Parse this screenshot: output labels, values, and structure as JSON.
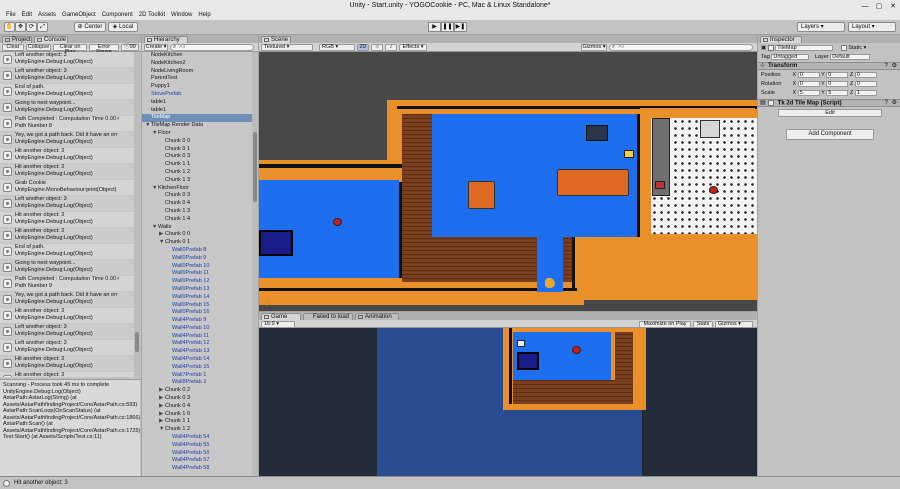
{
  "window": {
    "title": "Unity - Start.unity - YOGOCookie - PC, Mac & Linux Standalone*",
    "minimize": "—",
    "maximize": "▢",
    "close": "✕"
  },
  "menu": [
    "File",
    "Edit",
    "Assets",
    "GameObject",
    "Component",
    "2D Toolkit",
    "Window",
    "Help"
  ],
  "toolbar": {
    "pivot": "Center",
    "space": "Local",
    "play": "▶",
    "pause": "❚❚",
    "step": "▶❚",
    "layers": "Layers",
    "layout": "Layout"
  },
  "project_panel": {
    "tab_project": "Project",
    "tab_console": "Console",
    "clear": "Clear",
    "collapse": "Collapse",
    "clear_on_play": "Clear on Play",
    "error_pause": "Error Pause",
    "count": "99"
  },
  "console_logs": [
    [
      "Left another object: 3",
      "UnityEngine.Debug:Log(Object)"
    ],
    [
      "Left another object: 3",
      "UnityEngine.Debug:Log(Object)"
    ],
    [
      "End of path.",
      "UnityEngine.Debug:Log(Object)"
    ],
    [
      "Going to next waypoint...",
      "UnityEngine.Debug:Log(Object)"
    ],
    [
      "Path Completed : Computation Time 0.00 r",
      "Path Number 8"
    ],
    [
      "Yey, we got a path back. Did it have an err",
      "UnityEngine.Debug:Log(Object)"
    ],
    [
      "Hit another object: 3",
      "UnityEngine.Debug:Log(Object)"
    ],
    [
      "Hit another object: 3",
      "UnityEngine.Debug:Log(Object)"
    ],
    [
      "Grab Cookie",
      "UnityEngine.MonoBehaviour:print(Object)"
    ],
    [
      "Left another object: 3",
      "UnityEngine.Debug:Log(Object)"
    ],
    [
      "Hit another object: 3",
      "UnityEngine.Debug:Log(Object)"
    ],
    [
      "Hit another object: 3",
      "UnityEngine.Debug:Log(Object)"
    ],
    [
      "End of path.",
      "UnityEngine.Debug:Log(Object)"
    ],
    [
      "Going to next waypoint...",
      "UnityEngine.Debug:Log(Object)"
    ],
    [
      "Path Completed : Computation Time 0.00 r",
      "Path Number 9"
    ],
    [
      "Yey, we got a path back. Did it have an err",
      "UnityEngine.Debug:Log(Object)"
    ],
    [
      "Hit another object: 3",
      "UnityEngine.Debug:Log(Object)"
    ],
    [
      "Left another object: 3",
      "UnityEngine.Debug:Log(Object)"
    ],
    [
      "Left another object: 3",
      "UnityEngine.Debug:Log(Object)"
    ],
    [
      "Hit another object: 3",
      "UnityEngine.Debug:Log(Object)"
    ],
    [
      "Hit another object: 3",
      "UnityEngine.Debug:Log(Object)"
    ]
  ],
  "console_detail": "Scanning - Process took 45 ms to complete\nUnityEngine.Debug:Log(Object)\nAstarPath:AstarLog(String) (at Assets/AstarPathfindingProject/Core/AstarPath.cs:593)\nAstarPath:ScanLoop(OnScanStatus) (at Assets/AstarPathfindingProject/Core/AstarPath.cs:1866)\nAstarPath:Scan() (at Assets/AstarPathfindingProject/Core/AstarPath.cs:1725)\nTest:Start() (at Assets/Scripts/Test.cs:11)",
  "hierarchy": {
    "tab": "Hierarchy",
    "create": "Create ▾",
    "search_placeholder": "All",
    "rows": [
      {
        "label": "NodeKitchen",
        "indent": 0
      },
      {
        "label": "NodeKitchen2",
        "indent": 0
      },
      {
        "label": "NodeLivingRoom",
        "indent": 0
      },
      {
        "label": "ParentTest",
        "indent": 0
      },
      {
        "label": "Puppy1",
        "indent": 0
      },
      {
        "label": "StovePrefab",
        "indent": 0,
        "prefab": true
      },
      {
        "label": "table1",
        "indent": 0
      },
      {
        "label": "table1",
        "indent": 0
      },
      {
        "label": "TileMap",
        "indent": 0,
        "selected": true
      },
      {
        "label": "TileMap Render Data",
        "indent": 0,
        "arrow": "▼"
      },
      {
        "label": "Floor",
        "indent": 1,
        "arrow": "▼"
      },
      {
        "label": "Chunk 0 0",
        "indent": 2
      },
      {
        "label": "Chunk 0 1",
        "indent": 2
      },
      {
        "label": "Chunk 0 3",
        "indent": 2
      },
      {
        "label": "Chunk 1 1",
        "indent": 2
      },
      {
        "label": "Chunk 1 2",
        "indent": 2
      },
      {
        "label": "Chunk 1 3",
        "indent": 2
      },
      {
        "label": "KitchenFloor",
        "indent": 1,
        "arrow": "▼"
      },
      {
        "label": "Chunk 0 3",
        "indent": 2
      },
      {
        "label": "Chunk 0 4",
        "indent": 2
      },
      {
        "label": "Chunk 1 3",
        "indent": 2
      },
      {
        "label": "Chunk 1 4",
        "indent": 2
      },
      {
        "label": "Walls",
        "indent": 1,
        "arrow": "▼"
      },
      {
        "label": "Chunk 0 0",
        "indent": 2,
        "arrow": "▶"
      },
      {
        "label": "Chunk 0 1",
        "indent": 2,
        "arrow": "▼"
      },
      {
        "label": "Wall0Prefab 8",
        "indent": 3,
        "prefab": true
      },
      {
        "label": "Wall0Prefab 9",
        "indent": 3,
        "prefab": true
      },
      {
        "label": "Wall0Prefab 10",
        "indent": 3,
        "prefab": true
      },
      {
        "label": "Wall0Prefab 11",
        "indent": 3,
        "prefab": true
      },
      {
        "label": "Wall0Prefab 12",
        "indent": 3,
        "prefab": true
      },
      {
        "label": "Wall0Prefab 13",
        "indent": 3,
        "prefab": true
      },
      {
        "label": "Wall0Prefab 14",
        "indent": 3,
        "prefab": true
      },
      {
        "label": "Wall0Prefab 15",
        "indent": 3,
        "prefab": true
      },
      {
        "label": "Wall0Prefab 16",
        "indent": 3,
        "prefab": true
      },
      {
        "label": "Wall4Prefab 9",
        "indent": 3,
        "prefab": true
      },
      {
        "label": "Wall4Prefab 10",
        "indent": 3,
        "prefab": true
      },
      {
        "label": "Wall4Prefab 11",
        "indent": 3,
        "prefab": true
      },
      {
        "label": "Wall4Prefab 12",
        "indent": 3,
        "prefab": true
      },
      {
        "label": "Wall4Prefab 13",
        "indent": 3,
        "prefab": true
      },
      {
        "label": "Wall4Prefab 14",
        "indent": 3,
        "prefab": true
      },
      {
        "label": "Wall4Prefab 15",
        "indent": 3,
        "prefab": true
      },
      {
        "label": "Wall7Prefab 1",
        "indent": 3,
        "prefab": true
      },
      {
        "label": "Wall8Prefab 2",
        "indent": 3,
        "prefab": true
      },
      {
        "label": "Chunk 0 2",
        "indent": 2,
        "arrow": "▶"
      },
      {
        "label": "Chunk 0 3",
        "indent": 2,
        "arrow": "▶"
      },
      {
        "label": "Chunk 0 4",
        "indent": 2,
        "arrow": "▶"
      },
      {
        "label": "Chunk 1 0",
        "indent": 2,
        "arrow": "▶"
      },
      {
        "label": "Chunk 1 1",
        "indent": 2,
        "arrow": "▶"
      },
      {
        "label": "Chunk 1 2",
        "indent": 2,
        "arrow": "▼"
      },
      {
        "label": "Wall4Prefab 54",
        "indent": 3,
        "prefab": true
      },
      {
        "label": "Wall4Prefab 55",
        "indent": 3,
        "prefab": true
      },
      {
        "label": "Wall4Prefab 56",
        "indent": 3,
        "prefab": true
      },
      {
        "label": "Wall4Prefab 57",
        "indent": 3,
        "prefab": true
      },
      {
        "label": "Wall4Prefab 58",
        "indent": 3,
        "prefab": true
      }
    ]
  },
  "scene": {
    "tab": "Scene",
    "shading": "Textured ▾",
    "render": "RGB ▾",
    "mode_2d": "2D",
    "effects": "Effects ▾",
    "gizmos": "Gizmos ▾",
    "search_placeholder": "All"
  },
  "game": {
    "tab": "Game",
    "tab_failed": "Failed to load",
    "tab_animation": "Animation",
    "aspect": "16:9 ▾",
    "maximize": "Maximize on Play",
    "stats": "Stats",
    "gizmos": "Gizmos ▾"
  },
  "inspector": {
    "tab": "Inspector",
    "object_name": "TileMap",
    "static_label": "Static ▾",
    "tag_label": "Tag",
    "tag_value": "Untagged",
    "layer_label": "Layer",
    "layer_value": "Default",
    "transform_title": "Transform",
    "position_label": "Position",
    "rotation_label": "Rotation",
    "scale_label": "Scale",
    "position": [
      "0",
      "0",
      "0"
    ],
    "rotation": [
      "0",
      "0",
      "0"
    ],
    "scale": [
      "5",
      "5",
      "1"
    ],
    "axis_x": "X",
    "axis_y": "Y",
    "axis_z": "Z",
    "component_title": "Tk 2d Tile Map (Script)",
    "edit_button": "Edit",
    "add_component": "Add Component"
  },
  "status": {
    "message": "Hit another object: 3"
  }
}
